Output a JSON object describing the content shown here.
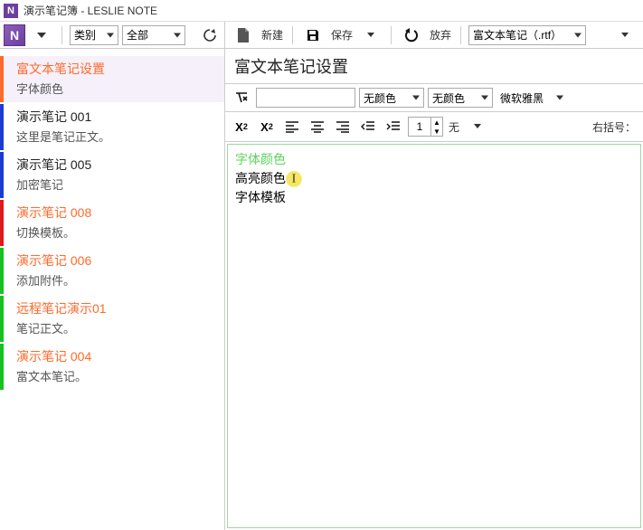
{
  "window": {
    "title": "演示笔记簿 - LESLIE NOTE"
  },
  "topLeft": {
    "categoryLabel": "类别",
    "filterLabel": "全部"
  },
  "topRight": {
    "newLabel": "新建",
    "saveLabel": "保存",
    "discardLabel": "放弃",
    "formatLabel": "富文本笔记（.rtf）"
  },
  "sidebar": {
    "items": [
      {
        "title": "富文本笔记设置",
        "sub": "字体颜色",
        "color": "#ff6a2a",
        "titleColor": "#ff6a2a",
        "selected": true
      },
      {
        "title": "演示笔记 001",
        "sub": "这里是笔记正文。",
        "color": "#1a3bd6",
        "titleColor": "#222"
      },
      {
        "title": "演示笔记 005",
        "sub": "加密笔记",
        "color": "#1a3bd6",
        "titleColor": "#222"
      },
      {
        "title": "演示笔记 008",
        "sub": "切换模板。",
        "color": "#e01919",
        "titleColor": "#ff6a2a"
      },
      {
        "title": "演示笔记 006",
        "sub": "添加附件。",
        "color": "#17c21f",
        "titleColor": "#ff6a2a"
      },
      {
        "title": "远程笔记演示01",
        "sub": "笔记正文。",
        "color": "#17c21f",
        "titleColor": "#ff6a2a"
      },
      {
        "title": "演示笔记 004",
        "sub": "富文本笔记。",
        "color": "#17c21f",
        "titleColor": "#ff6a2a"
      }
    ]
  },
  "note": {
    "title": "富文本笔记设置",
    "format1": {
      "colorSel1": "无颜色",
      "colorSel2": "无颜色",
      "fontSel": "微软雅黑"
    },
    "format2": {
      "lineSpacing": "1",
      "noneLabel": "无",
      "rightLabelPrefix": "右括号："
    },
    "body": {
      "line1": "字体颜色",
      "line2": "高亮颜色",
      "line3": "字体模板"
    }
  }
}
